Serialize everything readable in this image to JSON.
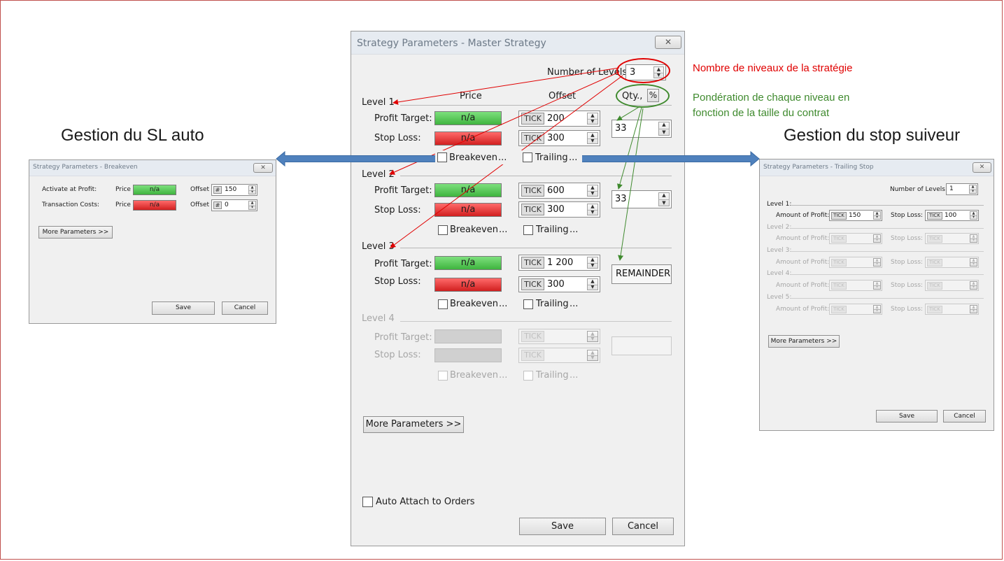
{
  "colors": {
    "red_annotation": "#e00000",
    "green_annotation": "#3f8a2e",
    "blue_arrow": "#4f81bd",
    "profit_green": "#43b443",
    "stop_red": "#d62020"
  },
  "captions": {
    "left": "Gestion du SL auto",
    "right": "Gestion du stop suiveur"
  },
  "annotations": {
    "levels_note": "Nombre de niveaux de la stratégie",
    "weight_note_line1": "Pondération de chaque niveau en",
    "weight_note_line2": "fonction de la taille du contrat"
  },
  "main": {
    "title": "Strategy Parameters - Master Strategy",
    "close_icon": "✕",
    "num_levels_label": "Number of Levels:",
    "num_levels_value": "3",
    "col_price": "Price",
    "col_offset": "Offset",
    "col_qty": "Qty.,",
    "qty_pct": "%",
    "profit_label": "Profit Target:",
    "stop_label": "Stop Loss:",
    "na": "n/a",
    "tick": "TICK",
    "breakeven": "Breakeven",
    "trailing": "Trailing",
    "ellipsis": "...",
    "levels": [
      {
        "name": "Level 1",
        "profit_offset": "200",
        "stop_offset": "300",
        "qty": "33"
      },
      {
        "name": "Level 2",
        "profit_offset": "600",
        "stop_offset": "300",
        "qty": "33"
      },
      {
        "name": "Level 3",
        "profit_offset": "1 200",
        "stop_offset": "300",
        "qty": "REMAINDER"
      },
      {
        "name": "Level 4",
        "profit_offset": "",
        "stop_offset": "",
        "qty": ""
      }
    ],
    "more_params": "More Parameters >>",
    "auto_attach": "Auto Attach to Orders",
    "save": "Save",
    "cancel": "Cancel"
  },
  "breakeven": {
    "title": "Strategy Parameters - Breakeven",
    "close_icon": "✕",
    "activate_label": "Activate at Profit:",
    "costs_label": "Transaction Costs:",
    "price_label": "Price",
    "na": "n/a",
    "offset_label": "Offset",
    "hash": "#",
    "activate_offset": "150",
    "costs_offset": "0",
    "more_params": "More Parameters >>",
    "save": "Save",
    "cancel": "Cancel"
  },
  "trailing": {
    "title": "Strategy Parameters - Trailing Stop",
    "close_icon": "✕",
    "num_levels_label": "Number of Levels:",
    "num_levels_value": "1",
    "amount_label": "Amount of Profit:",
    "stop_label": "Stop Loss:",
    "tick": "TICK",
    "levels": [
      {
        "name": "Level 1:",
        "amount": "150",
        "stop": "100"
      },
      {
        "name": "Level 2:",
        "amount": "",
        "stop": ""
      },
      {
        "name": "Level 3:",
        "amount": "",
        "stop": ""
      },
      {
        "name": "Level 4:",
        "amount": "",
        "stop": ""
      },
      {
        "name": "Level 5:",
        "amount": "",
        "stop": ""
      }
    ],
    "more_params": "More Parameters >>",
    "save": "Save",
    "cancel": "Cancel"
  }
}
